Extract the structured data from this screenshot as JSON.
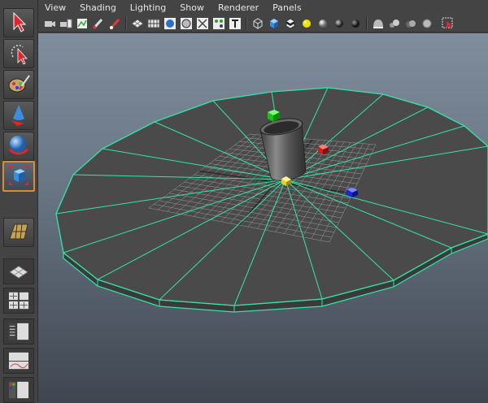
{
  "menubar": {
    "items": [
      {
        "label": "View"
      },
      {
        "label": "Shading"
      },
      {
        "label": "Lighting"
      },
      {
        "label": "Show"
      },
      {
        "label": "Renderer"
      },
      {
        "label": "Panels"
      }
    ]
  },
  "toolbox": {
    "tools": [
      {
        "name": "select-tool",
        "icon": "arrow-icon"
      },
      {
        "name": "lasso-tool",
        "icon": "lasso-icon"
      },
      {
        "name": "paint-select-tool",
        "icon": "brush-icon"
      },
      {
        "name": "move-tool",
        "icon": "cone-icon"
      },
      {
        "name": "rotate-tool",
        "icon": "sphere-icon"
      },
      {
        "name": "scale-tool",
        "icon": "cube-icon",
        "active": true
      },
      {
        "name": "last-tool",
        "icon": "grid-plane-icon"
      }
    ],
    "layouts": [
      "single-perspective",
      "four-view",
      "outliner-persp",
      "graph-persp",
      "hypershade-persp"
    ]
  },
  "colors": {
    "active_border": "#e08a2c",
    "wireframe": "#33e6a6",
    "viewport_top": "#7f8d9c",
    "viewport_bottom": "#3f4650"
  }
}
